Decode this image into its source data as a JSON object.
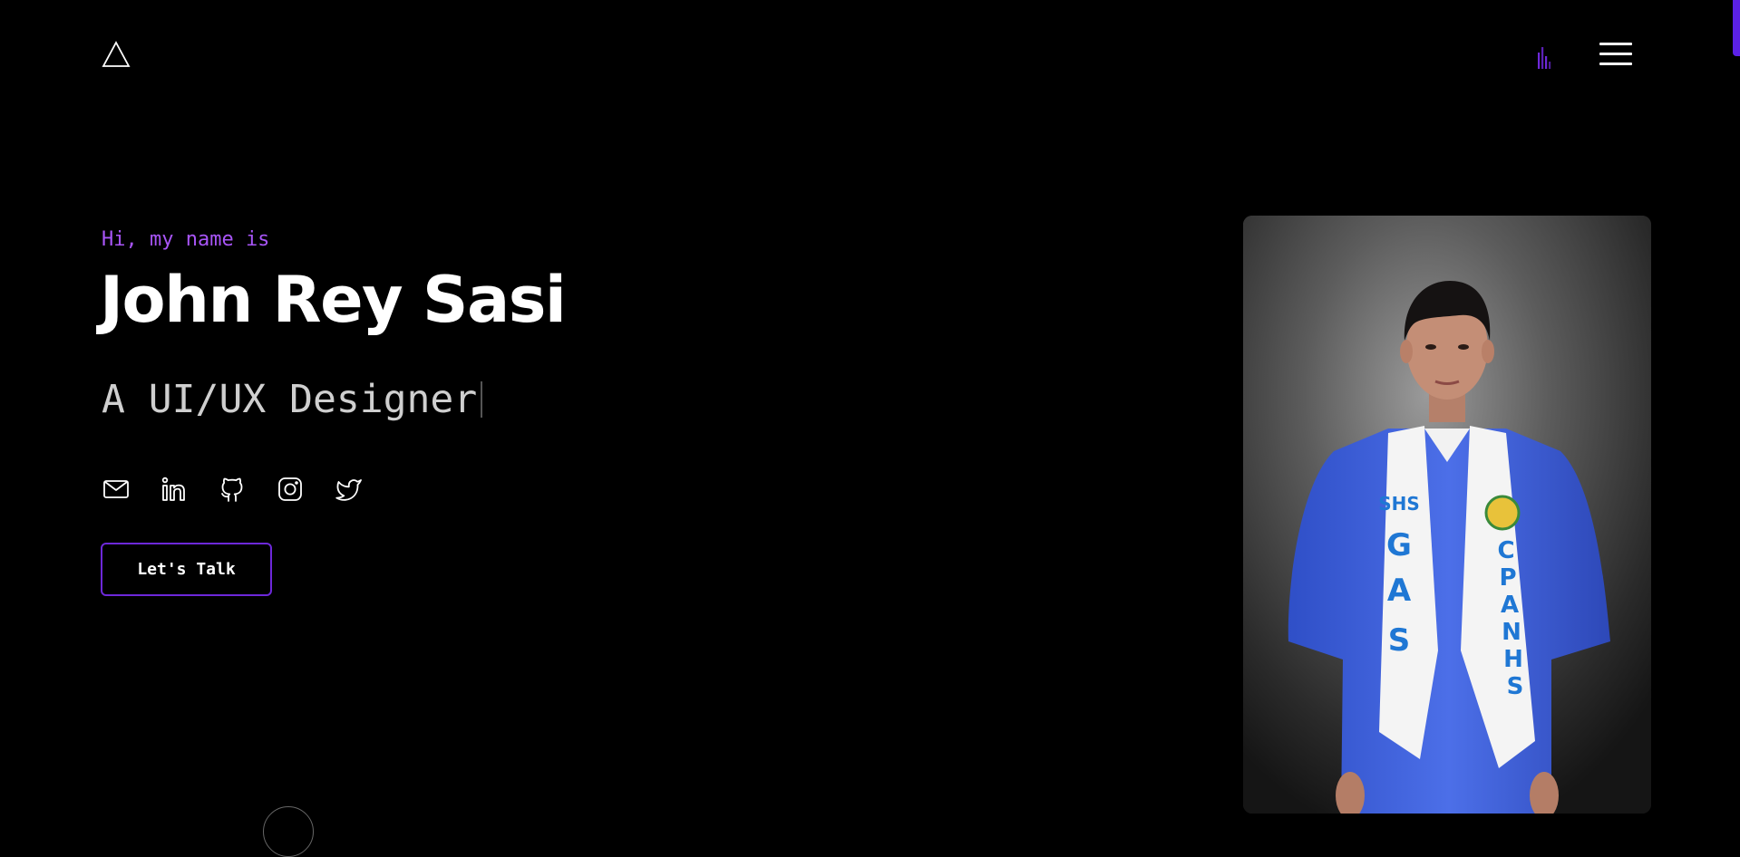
{
  "header": {
    "logo_icon": "triangle-logo-icon",
    "audio_icon": "audio-visualizer-icon",
    "menu_icon": "hamburger-menu-icon"
  },
  "hero": {
    "greeting": "Hi, my name is",
    "name": "John Rey Sasi",
    "role": "A UI/UX Designer",
    "cta_label": "Let's Talk"
  },
  "socials": [
    {
      "icon": "mail-icon"
    },
    {
      "icon": "linkedin-icon"
    },
    {
      "icon": "github-icon"
    },
    {
      "icon": "instagram-icon"
    },
    {
      "icon": "twitter-icon"
    }
  ],
  "portrait": {
    "stole_left_text": "SHS GAS",
    "stole_right_text": "CPANHS"
  },
  "colors": {
    "background": "#000000",
    "accent": "#a855f7",
    "button_border": "#6d28d9",
    "scroll_accent": "#5b21e6"
  }
}
